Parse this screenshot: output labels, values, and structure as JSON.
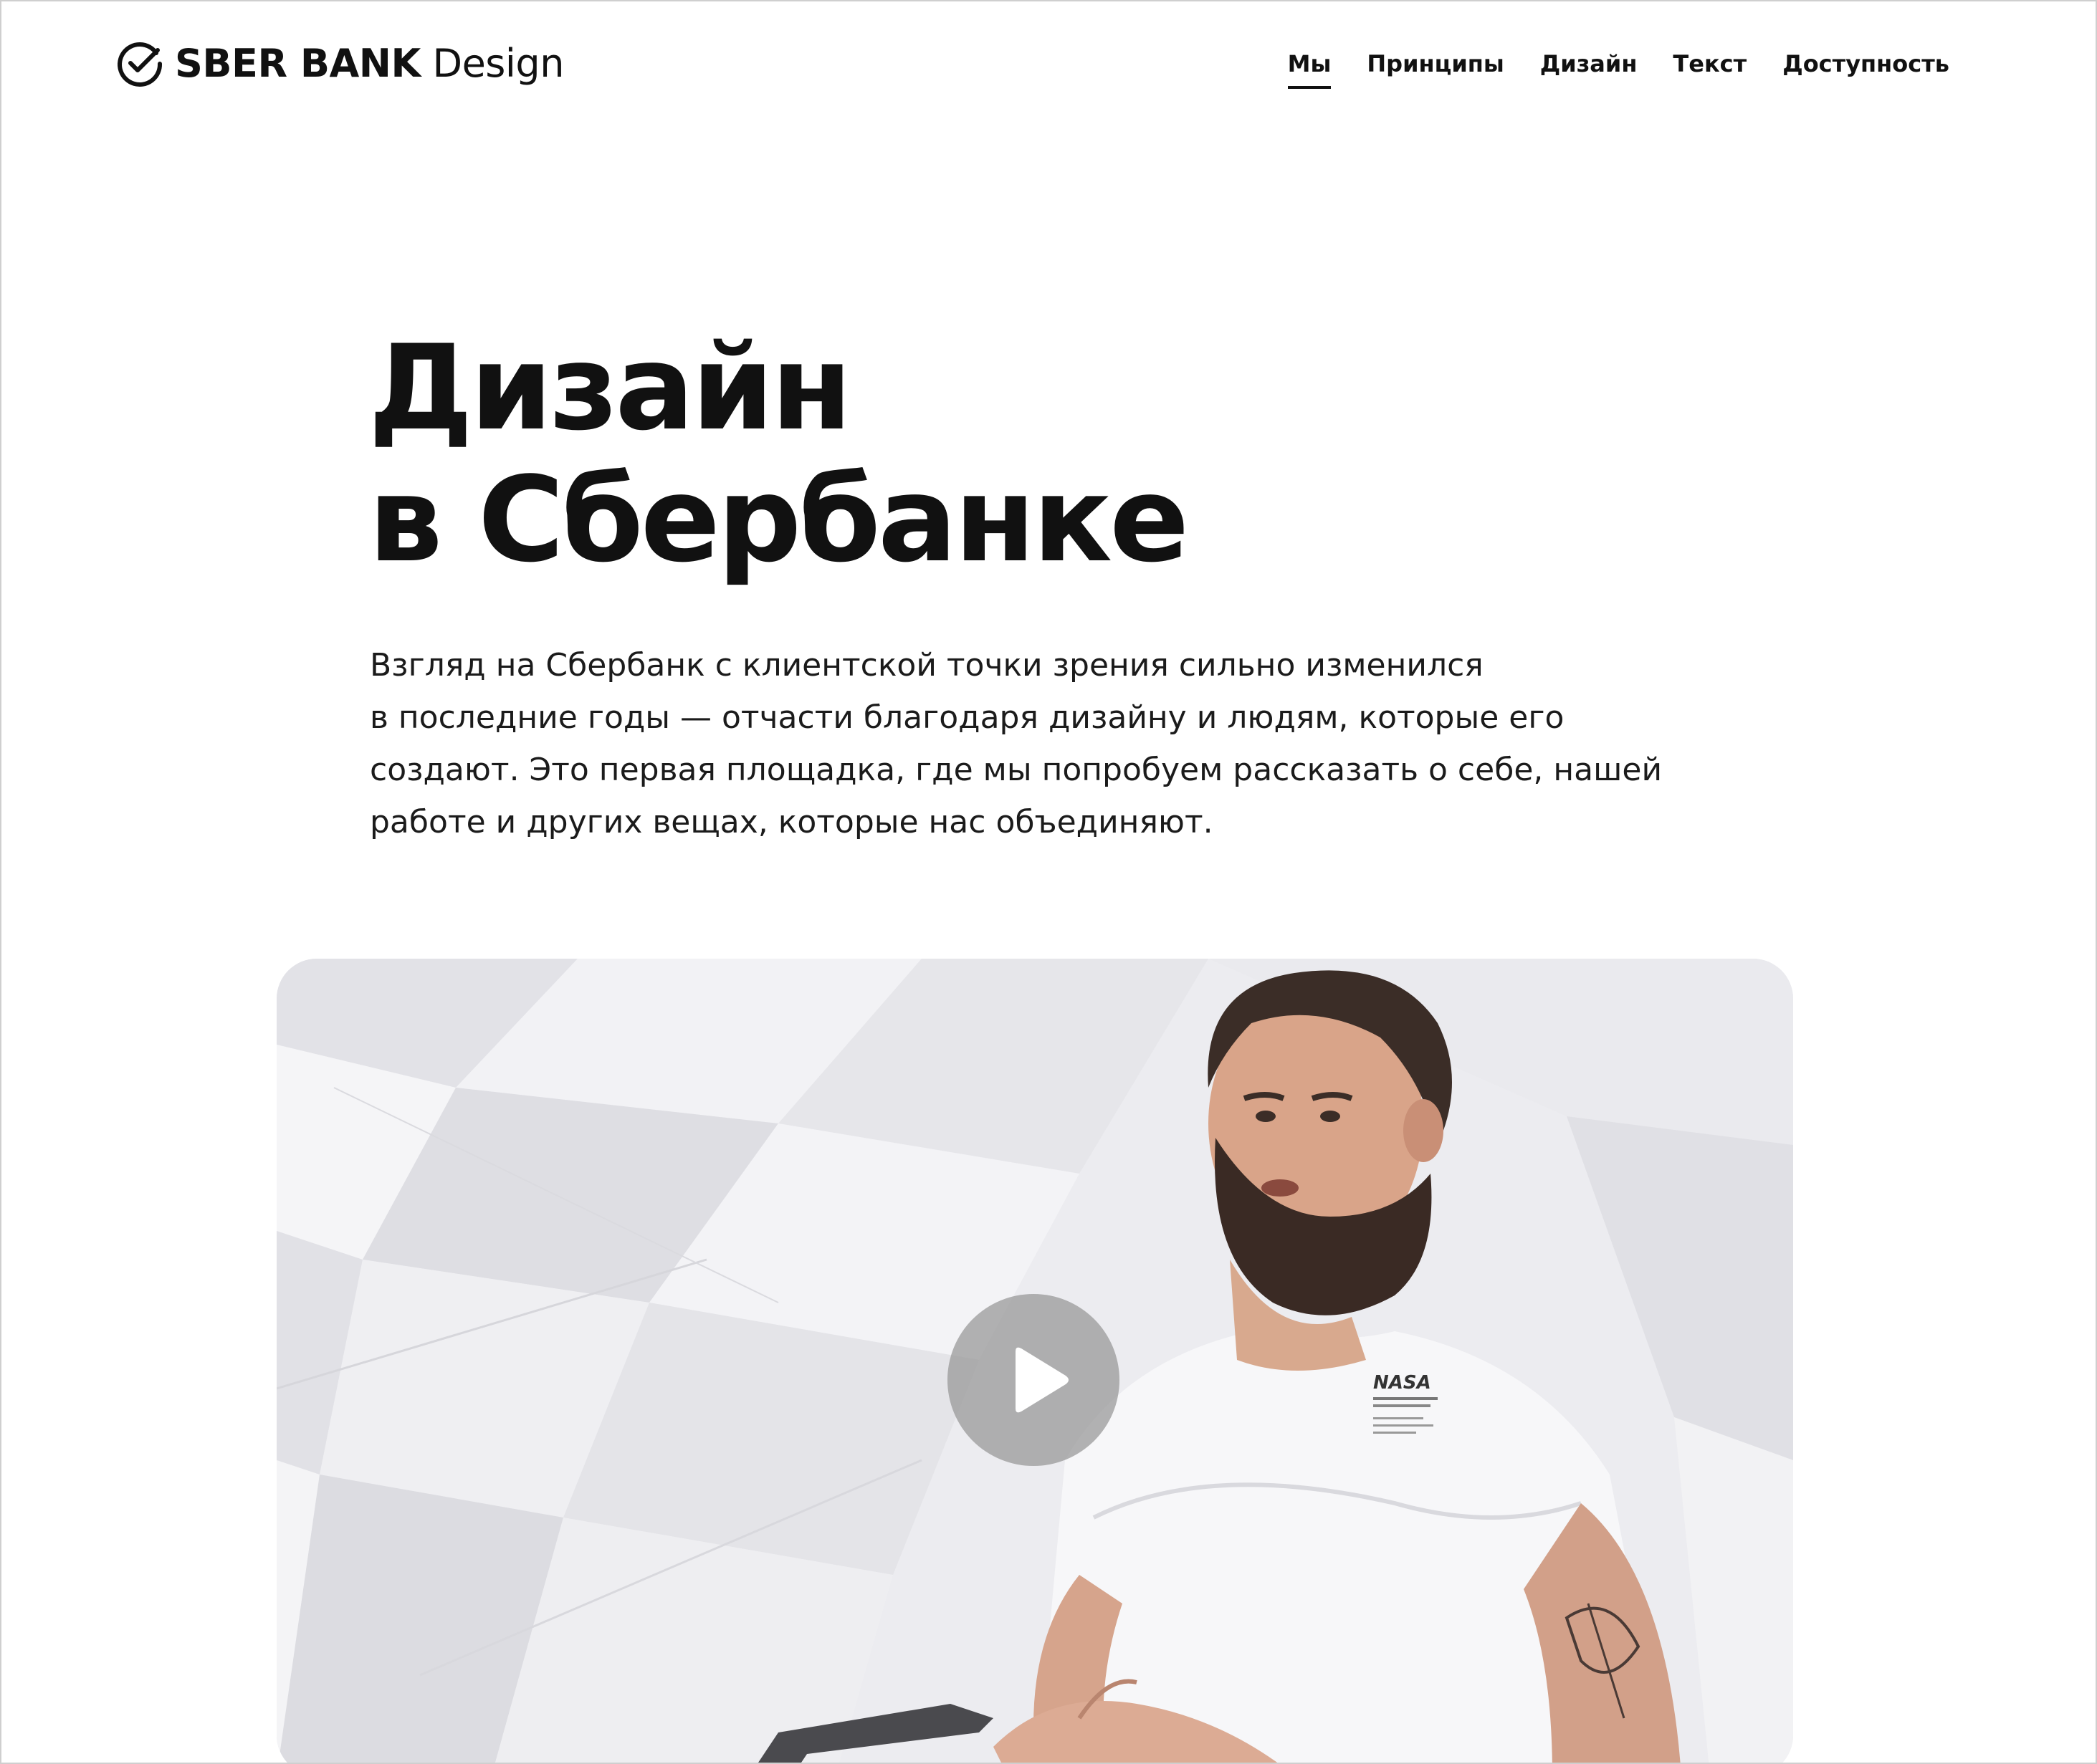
{
  "header": {
    "logo": {
      "icon": "sber-check-circle-icon",
      "brand": "SBER BANK",
      "suffix": "Design"
    },
    "nav": [
      {
        "label": "Мы",
        "active": true
      },
      {
        "label": "Принципы",
        "active": false
      },
      {
        "label": "Дизайн",
        "active": false
      },
      {
        "label": "Текст",
        "active": false
      },
      {
        "label": "Доступность",
        "active": false
      }
    ]
  },
  "hero": {
    "title_line1": "Дизайн",
    "title_line2": "в Сбербанке",
    "description_lines": [
      "Взгляд на Сбербанк с клиентской точки зрения сильно изменился",
      "в последние годы — отчасти благодаря дизайну и людям, которые его",
      "создают. Это первая площадка, где мы попробуем рассказать о себе, нашей",
      "работе и других вещах, которые нас объединяют."
    ]
  },
  "video": {
    "play_icon": "play-icon",
    "shirt_print": "NASA"
  },
  "colors": {
    "text": "#111111",
    "background": "#ffffff",
    "play_overlay": "#969696"
  }
}
